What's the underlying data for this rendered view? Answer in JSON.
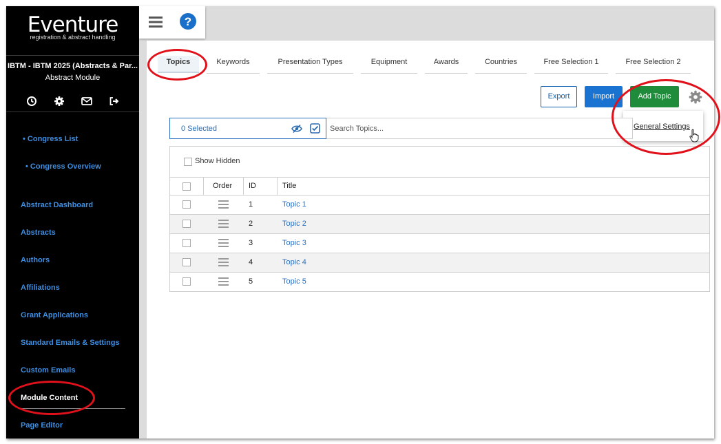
{
  "app": {
    "logo": "Eventure",
    "logo_subtitle": "registration & abstract handling",
    "congress": "IBTM - IBTM 2025 (Abstracts & Par...",
    "module": "Abstract Module"
  },
  "sidebar": {
    "icons": [
      "history-icon",
      "gear-icon",
      "mail-icon",
      "logout-icon"
    ],
    "top_links": [
      {
        "label": "• Congress List"
      },
      {
        "label": "• Congress Overview"
      }
    ],
    "items": [
      {
        "label": "Abstract Dashboard"
      },
      {
        "label": "Abstracts"
      },
      {
        "label": "Authors"
      },
      {
        "label": "Affiliations"
      },
      {
        "label": "Grant Applications"
      },
      {
        "label": "Standard Emails & Settings"
      },
      {
        "label": "Custom Emails"
      },
      {
        "label": "Module Content",
        "active": true
      },
      {
        "label": "Page Editor"
      }
    ]
  },
  "topbar": {
    "icons": [
      "hamburger-menu-icon",
      "help-icon"
    ]
  },
  "tabs": [
    {
      "label": "Topics",
      "active": true
    },
    {
      "label": "Keywords"
    },
    {
      "label": "Presentation Types"
    },
    {
      "label": "Equipment"
    },
    {
      "label": "Awards"
    },
    {
      "label": "Countries"
    },
    {
      "label": "Free Selection 1"
    },
    {
      "label": "Free Selection 2"
    }
  ],
  "toolbar": {
    "export_label": "Export",
    "import_label": "Import",
    "add_label": "Add Topic",
    "settings_menu": "General Settings"
  },
  "filter": {
    "selected_text": "0 Selected",
    "search_placeholder": "Search Topics..."
  },
  "table": {
    "show_hidden_label": "Show Hidden",
    "headers": {
      "order": "Order",
      "id": "ID",
      "title": "Title"
    },
    "rows": [
      {
        "id": "1",
        "title": "Topic 1"
      },
      {
        "id": "2",
        "title": "Topic 2"
      },
      {
        "id": "3",
        "title": "Topic 3"
      },
      {
        "id": "4",
        "title": "Topic 4"
      },
      {
        "id": "5",
        "title": "Topic 5"
      }
    ]
  },
  "colors": {
    "sidebar_bg": "#000000",
    "link": "#3d8fe4",
    "primary": "#1a73d0",
    "success": "#1e8c3a",
    "annotation": "#e0111a"
  }
}
